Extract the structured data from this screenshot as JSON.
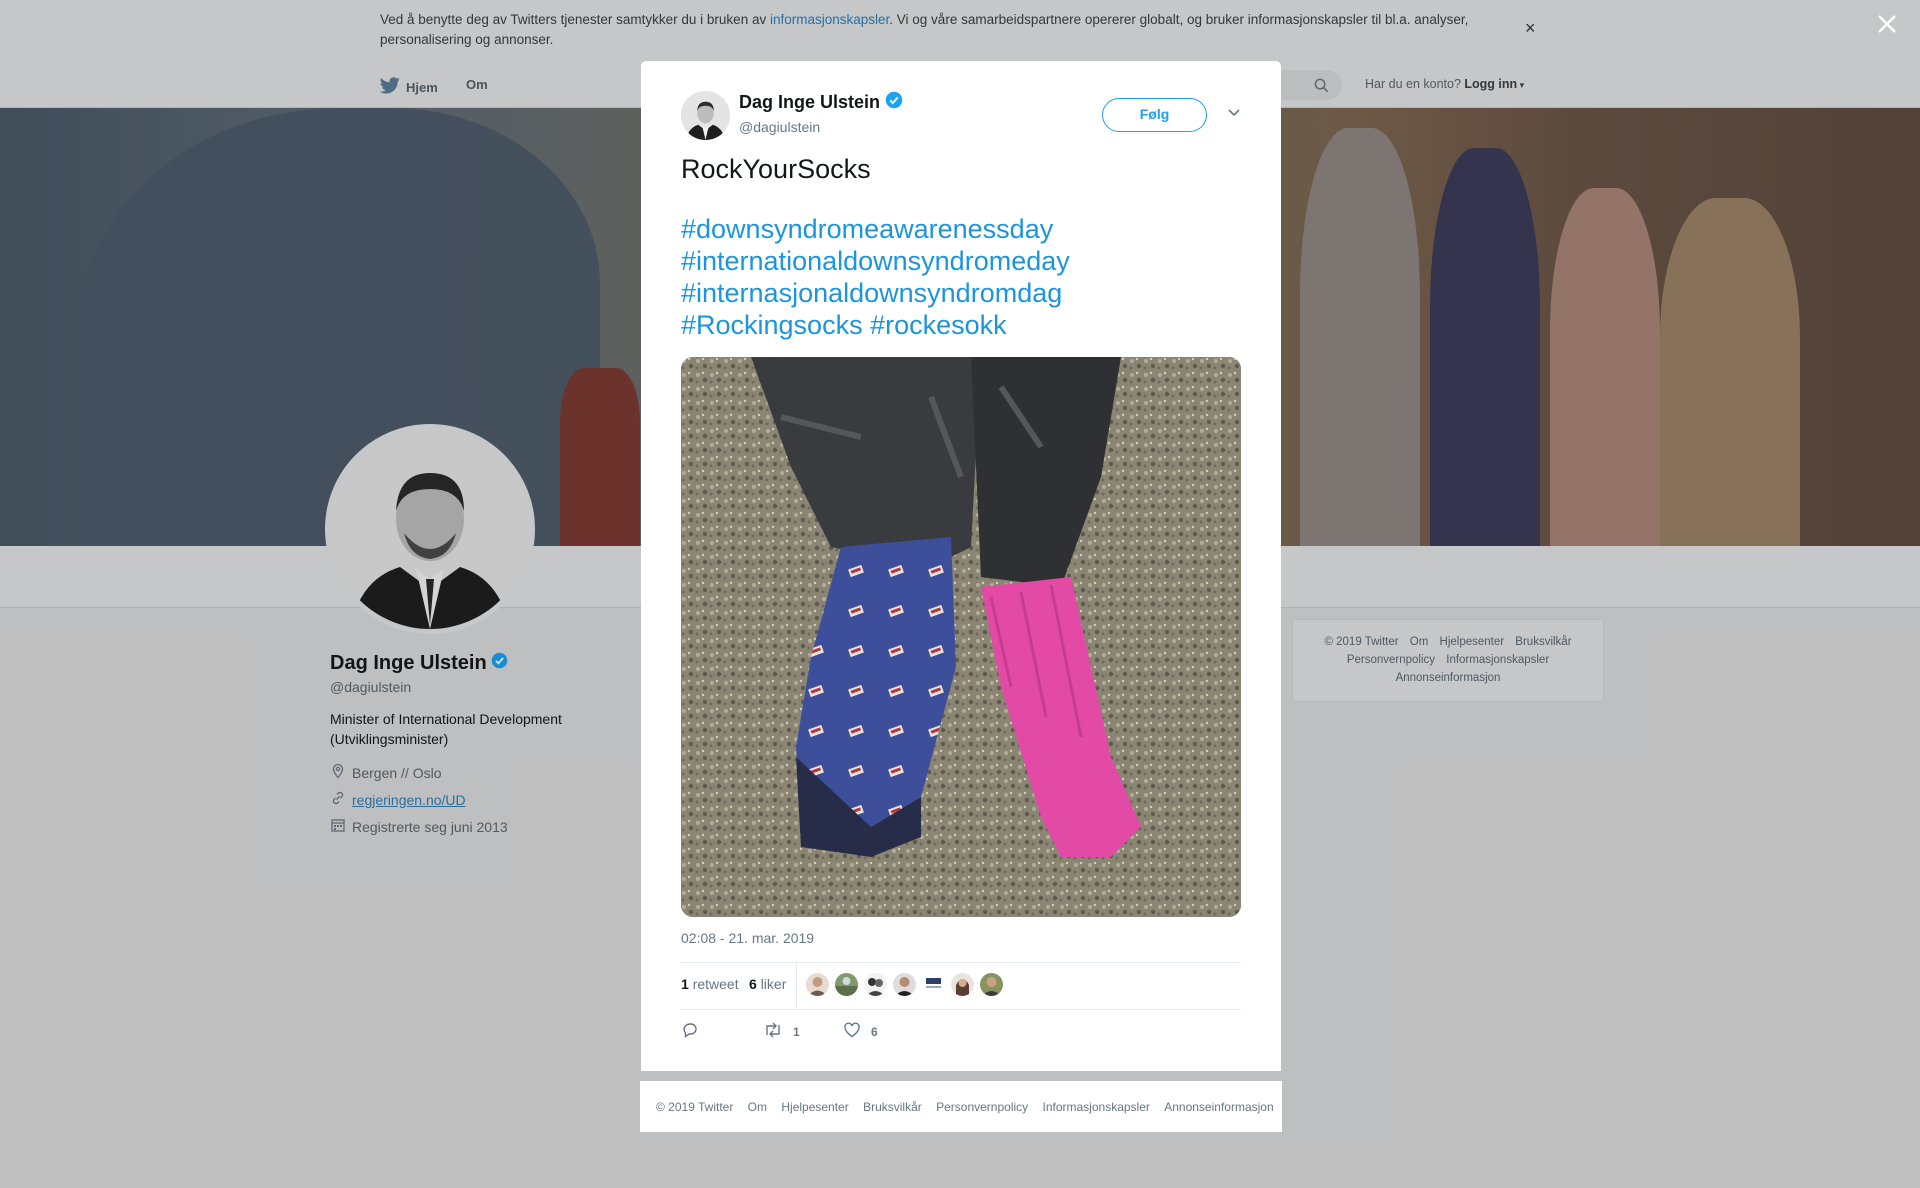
{
  "cookie_bar": {
    "text_before": "Ved å benytte deg av Twitters tjenester samtykker du i bruken av ",
    "link_text": "informasjonskapsler",
    "text_after": ". Vi og våre samarbeidspartnere opererer globalt, og bruker informasjonskapsler til bl.a. analyser, personalisering og annonser.",
    "close_label": "×"
  },
  "topnav": {
    "home_label": "Hjem",
    "about_label": "Om",
    "account_prompt": "Har du en konto?",
    "login_label": "Logg inn"
  },
  "profile": {
    "name": "Dag Inge Ulstein",
    "handle": "@dagiulstein",
    "bio": "Minister of International Development (Utviklingsminister)",
    "location": "Bergen // Oslo",
    "website": "regjeringen.no/UD",
    "joined": "Registrerte seg juni 2013"
  },
  "side_footer": {
    "row1": [
      "© 2019 Twitter",
      "Om",
      "Hjelpesenter",
      "Bruksvilkår"
    ],
    "row2": [
      "Personvernpolicy",
      "Informasjonskapsler"
    ],
    "row3": [
      "Annonseinformasjon"
    ]
  },
  "tweet": {
    "author_name": "Dag Inge Ulstein",
    "author_handle": "@dagiulstein",
    "follow_label": "Følg",
    "text": "RockYourSocks",
    "hashtags": [
      "#downsyndromeawarenessday",
      "#internationaldownsyndromeday",
      "#internasjonaldownsyndromdag",
      "#Rockingsocks",
      "#rockesokk"
    ],
    "timestamp": "02:08 - 21. mar. 2019",
    "retweet_count": "1",
    "retweet_label": "retweet",
    "like_count": "6",
    "like_label": "liker",
    "action_retweets": "1",
    "action_likes": "6"
  },
  "modal_footer": [
    "© 2019 Twitter",
    "Om",
    "Hjelpesenter",
    "Bruksvilkår",
    "Personvernpolicy",
    "Informasjonskapsler",
    "Annonseinformasjon"
  ],
  "icons": [
    "twitter-bird-icon",
    "search-icon",
    "verified-badge-icon",
    "chevron-down-icon",
    "location-icon",
    "link-icon",
    "calendar-icon",
    "reply-icon",
    "retweet-icon",
    "like-icon",
    "close-icon"
  ],
  "colors": {
    "accent": "#1da1f2",
    "link": "#1b95e0",
    "muted_text": "#657786"
  }
}
